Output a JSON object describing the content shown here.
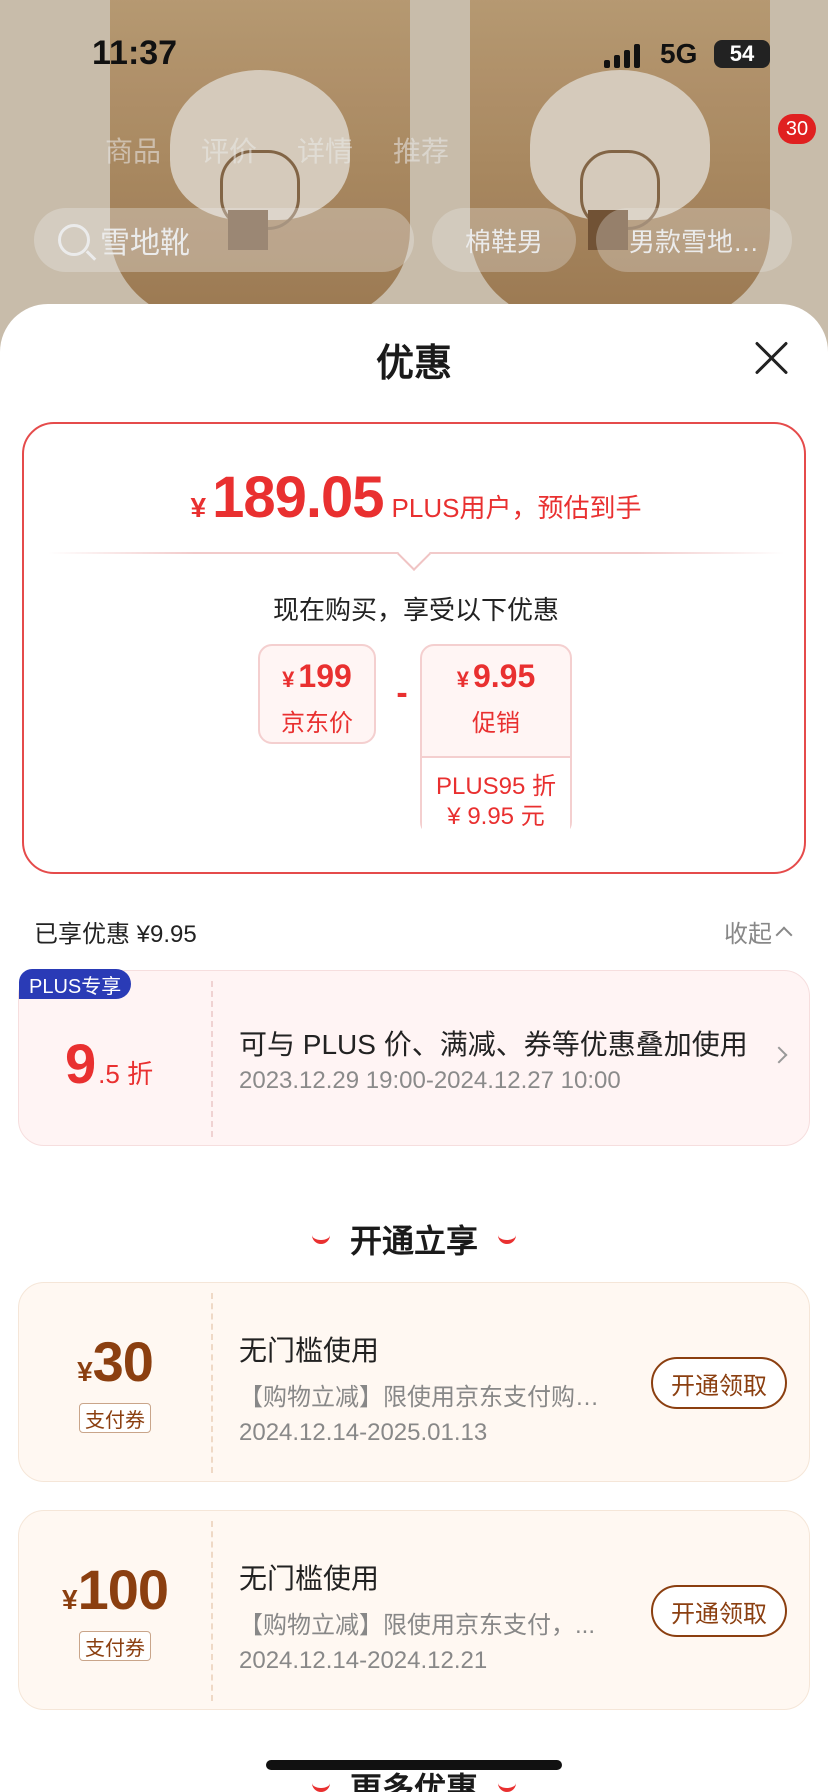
{
  "status_bar": {
    "time": "11:37",
    "network": "5G",
    "battery": "54"
  },
  "background": {
    "tabs": [
      "商品",
      "评价",
      "详情",
      "推荐"
    ],
    "search_placeholder": "雪地靴",
    "tags": [
      "棉鞋男",
      "男款雪地…"
    ],
    "cart_count": "30"
  },
  "sheet": {
    "title": "优惠",
    "estimate": {
      "currency": "¥",
      "price": "189.05",
      "note": "PLUS用户，预估到手"
    },
    "buy_now_text": "现在购买，享受以下优惠",
    "jd_price": {
      "currency": "¥",
      "amount": "199",
      "label": "京东价"
    },
    "minus": "-",
    "promo": {
      "currency": "¥",
      "amount": "9.95",
      "label": "促销",
      "detail_line1": "PLUS95 折",
      "detail_line2": "¥ 9.95 元"
    },
    "enjoyed_text": "已享优惠 ¥9.95",
    "collapse_label": "收起",
    "plus_offer": {
      "badge": "PLUS专享",
      "discount_main": "9",
      "discount_sub": ".5 折",
      "description": "可与 PLUS 价、满减、券等优惠叠加使用",
      "dates": "2023.12.29 19:00-2024.12.27 10:00"
    },
    "open_section_title": "开通立享",
    "coupons": [
      {
        "currency": "¥",
        "amount": "30",
        "tag": "支付券",
        "title": "无门槛使用",
        "description": "【购物立减】限使用京东支付购买...",
        "dates": "2024.12.14-2025.01.13",
        "button": "开通领取"
      },
      {
        "currency": "¥",
        "amount": "100",
        "tag": "支付券",
        "title": "无门槛使用",
        "description": "【购物立减】限使用京东支付，...",
        "dates": "2024.12.14-2024.12.21",
        "button": "开通领取"
      }
    ],
    "more_section_title": "更多优惠"
  },
  "colors": {
    "accent_red": "#e93030",
    "plus_blue": "#2a3bb6",
    "coupon_brown": "#8b3f10"
  }
}
